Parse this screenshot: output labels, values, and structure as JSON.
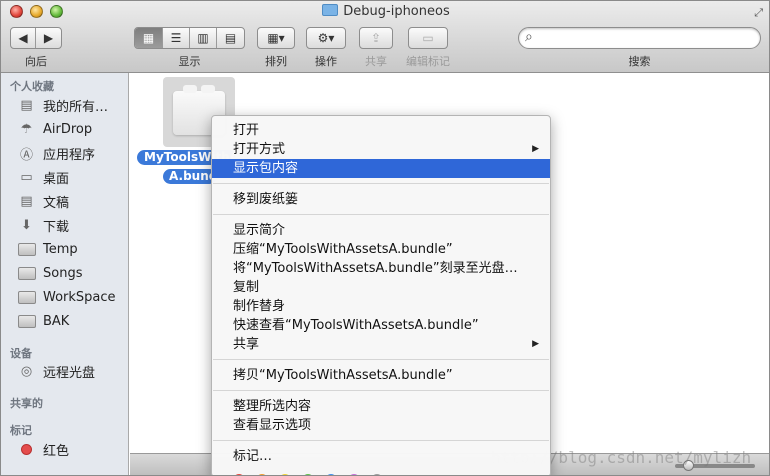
{
  "window": {
    "title": "Debug-iphoneos"
  },
  "toolbar": {
    "back_forward_label": "向后",
    "view_label": "显示",
    "arrange_label": "排列",
    "action_label": "操作",
    "share_label": "共享",
    "edit_tags_label": "编辑标记",
    "search_label": "搜索",
    "search_value": "",
    "search_placeholder": ""
  },
  "sidebar": {
    "favorites_header": "个人收藏",
    "favorites": [
      {
        "label": "我的所有…",
        "icon": "all-files-icon"
      },
      {
        "label": "AirDrop",
        "icon": "airdrop-icon"
      },
      {
        "label": "应用程序",
        "icon": "applications-icon"
      },
      {
        "label": "桌面",
        "icon": "desktop-icon"
      },
      {
        "label": "文稿",
        "icon": "documents-icon"
      },
      {
        "label": "下载",
        "icon": "downloads-icon"
      },
      {
        "label": "Temp",
        "icon": "folder-icon"
      },
      {
        "label": "Songs",
        "icon": "folder-icon"
      },
      {
        "label": "WorkSpace",
        "icon": "folder-icon"
      },
      {
        "label": "BAK",
        "icon": "folder-icon"
      }
    ],
    "devices_header": "设备",
    "devices": [
      {
        "label": "远程光盘",
        "icon": "remote-disc-icon"
      }
    ],
    "shared_header": "共享的",
    "tags_header": "标记",
    "tags": [
      {
        "label": "红色",
        "color": "#e44c4c"
      }
    ]
  },
  "content": {
    "file": {
      "name_line1": "MyToolsWithAssetsA.bundle",
      "name_line2": "A.bundle"
    }
  },
  "context_menu": {
    "items": {
      "open": "打开",
      "open_with": "打开方式",
      "show_package_contents": "显示包内容",
      "move_to_trash": "移到废纸篓",
      "get_info": "显示简介",
      "compress": "压缩“MyToolsWithAssetsA.bundle”",
      "burn": "将“MyToolsWithAssetsA.bundle”刻录至光盘…",
      "duplicate": "复制",
      "make_alias": "制作替身",
      "quick_look": "快速查看“MyToolsWithAssetsA.bundle”",
      "share": "共享",
      "copy": "拷贝“MyToolsWithAssetsA.bundle”",
      "clean_up": "整理所选内容",
      "show_view_options": "查看显示选项",
      "tags": "标记…"
    },
    "highlighted_item": "显示包内容",
    "tag_colors": [
      "#e8443c",
      "#f39a2b",
      "#f2d22e",
      "#5fc245",
      "#3f8ef0",
      "#c56ad9",
      "#9a9a9a"
    ]
  },
  "watermark": "http://blog.csdn.net/mylizh"
}
